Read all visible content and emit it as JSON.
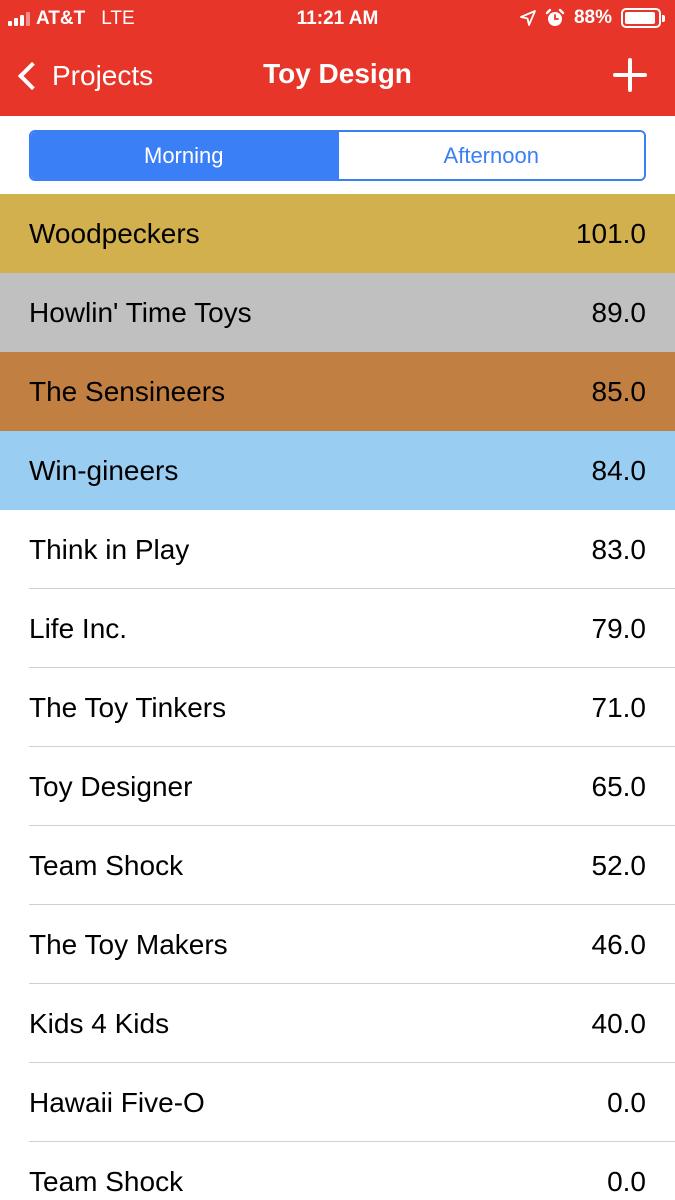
{
  "status_bar": {
    "carrier": "AT&T",
    "network": "LTE",
    "time": "11:21 AM",
    "battery_percent": "88%",
    "icons": [
      "signal-icon",
      "location-arrow-icon",
      "alarm-icon",
      "battery-icon"
    ]
  },
  "nav": {
    "back_label": "Projects",
    "title": "Toy Design",
    "add_icon": "plus-icon"
  },
  "segments": [
    {
      "label": "Morning",
      "selected": true
    },
    {
      "label": "Afternoon",
      "selected": false
    }
  ],
  "colors": {
    "nav_red": "#e8352a",
    "accent_blue": "#3a7ff6",
    "gold": "#d1b04d",
    "silver": "#c0c0c0",
    "bronze": "#c18042",
    "light_blue": "#9acdf2"
  },
  "teams": [
    {
      "name": "Woodpeckers",
      "score": "101.0",
      "highlight": "#d1b04d"
    },
    {
      "name": "Howlin' Time Toys",
      "score": "89.0",
      "highlight": "#c0c0c0"
    },
    {
      "name": "The Sensineers",
      "score": "85.0",
      "highlight": "#c18042"
    },
    {
      "name": "Win-gineers",
      "score": "84.0",
      "highlight": "#9acdf2"
    },
    {
      "name": "Think in Play",
      "score": "83.0"
    },
    {
      "name": "Life Inc.",
      "score": "79.0"
    },
    {
      "name": "The Toy Tinkers",
      "score": "71.0"
    },
    {
      "name": "Toy Designer",
      "score": "65.0"
    },
    {
      "name": "Team Shock",
      "score": "52.0"
    },
    {
      "name": "The Toy Makers",
      "score": "46.0"
    },
    {
      "name": "Kids 4 Kids",
      "score": "40.0"
    },
    {
      "name": "Hawaii Five-O",
      "score": "0.0"
    },
    {
      "name": "Team Shock",
      "score": "0.0"
    }
  ]
}
